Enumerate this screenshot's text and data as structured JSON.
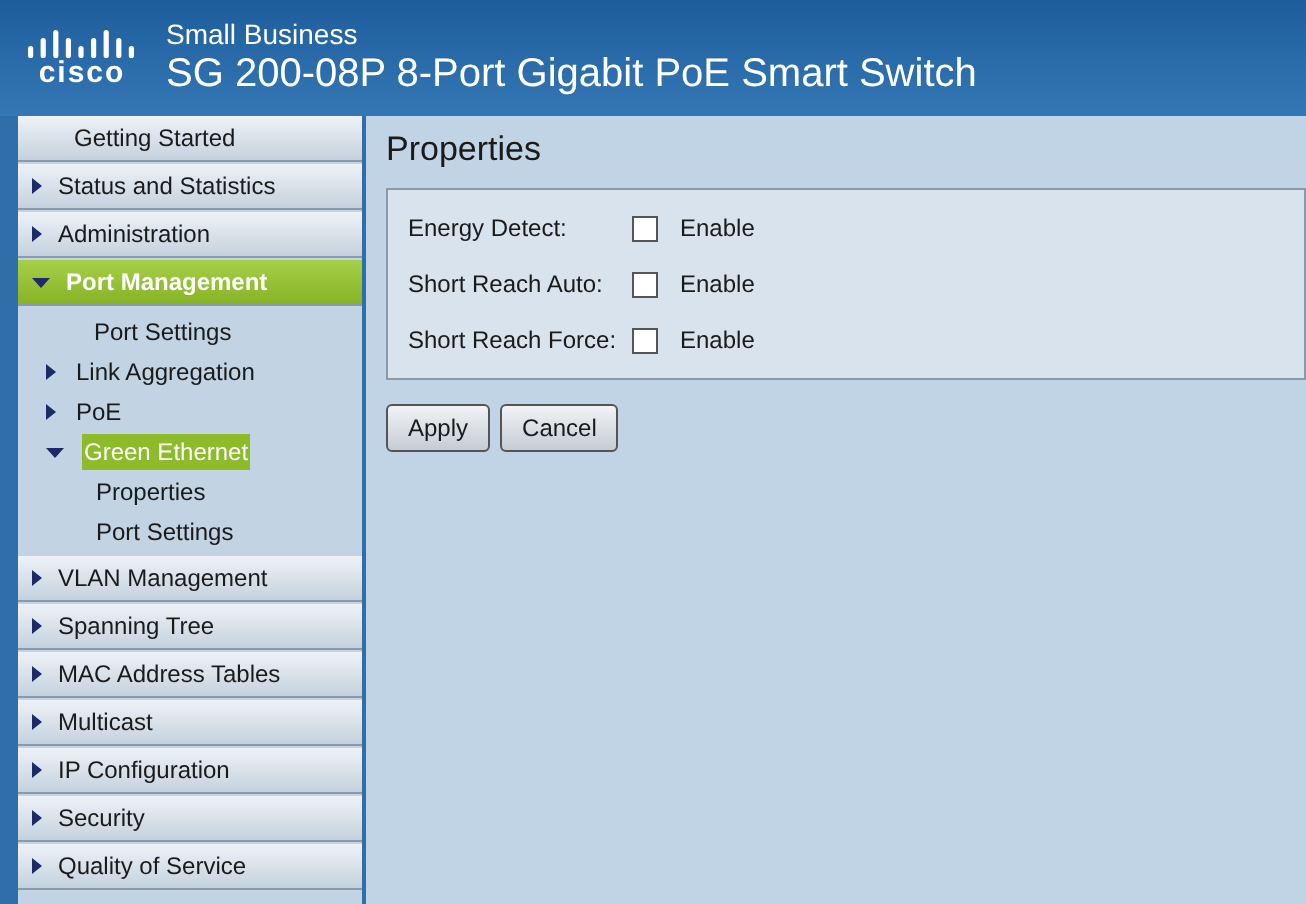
{
  "header": {
    "logo_text": "cisco",
    "product_line": "Small Business",
    "title": "SG 200-08P 8-Port Gigabit PoE Smart Switch"
  },
  "sidebar": {
    "items": [
      {
        "label": "Getting Started",
        "kind": "page",
        "selected": false
      },
      {
        "label": "Status and Statistics",
        "kind": "folder",
        "expanded": false,
        "selected": false
      },
      {
        "label": "Administration",
        "kind": "folder",
        "expanded": false,
        "selected": false
      },
      {
        "label": "Port Management",
        "kind": "folder",
        "expanded": true,
        "selected": true,
        "children": [
          {
            "label": "Port Settings",
            "kind": "page",
            "selected": false
          },
          {
            "label": "Link Aggregation",
            "kind": "folder",
            "expanded": false,
            "selected": false
          },
          {
            "label": "PoE",
            "kind": "folder",
            "expanded": false,
            "selected": false
          },
          {
            "label": "Green Ethernet",
            "kind": "folder",
            "expanded": true,
            "selected": true,
            "children": [
              {
                "label": "Properties",
                "kind": "page",
                "selected": false
              },
              {
                "label": "Port Settings",
                "kind": "page",
                "selected": false
              }
            ]
          }
        ]
      },
      {
        "label": "VLAN Management",
        "kind": "folder",
        "expanded": false,
        "selected": false
      },
      {
        "label": "Spanning Tree",
        "kind": "folder",
        "expanded": false,
        "selected": false
      },
      {
        "label": "MAC Address Tables",
        "kind": "folder",
        "expanded": false,
        "selected": false
      },
      {
        "label": "Multicast",
        "kind": "folder",
        "expanded": false,
        "selected": false
      },
      {
        "label": "IP Configuration",
        "kind": "folder",
        "expanded": false,
        "selected": false
      },
      {
        "label": "Security",
        "kind": "folder",
        "expanded": false,
        "selected": false
      },
      {
        "label": "Quality of Service",
        "kind": "folder",
        "expanded": false,
        "selected": false
      }
    ]
  },
  "page": {
    "title": "Properties",
    "fields": [
      {
        "label": "Energy Detect:",
        "option": "Enable",
        "checked": false
      },
      {
        "label": "Short Reach Auto:",
        "option": "Enable",
        "checked": false
      },
      {
        "label": "Short Reach Force:",
        "option": "Enable",
        "checked": false
      }
    ],
    "buttons": [
      "Apply",
      "Cancel"
    ]
  }
}
